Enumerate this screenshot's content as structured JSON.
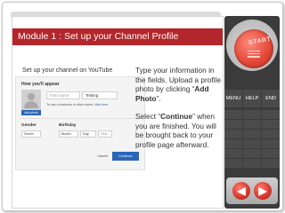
{
  "module": {
    "title": "Module 1 : Set up your Channel Profile"
  },
  "youtube": {
    "heading": "Set up your channel on YouTube",
    "how_label": "How you'll appear",
    "first_name_placeholder": "First name",
    "last_name_value": "Testing",
    "business_text": "To use a business or other name,",
    "business_link": "click here",
    "add_photo": "Add photo",
    "gender_label": "Gender",
    "birthday_label": "Birthday",
    "gender_select": "Select",
    "month_select": "Month",
    "day_select": "Day",
    "year_placeholder": "Year",
    "cancel_label": "Cancel",
    "continue_label": "Continue"
  },
  "instructions": {
    "p1_a": "Type your information in the fields. Upload a profile photo by clicking “",
    "p1_bold": "Add Photo",
    "p1_b": "”.",
    "p2_a": "Select “",
    "p2_bold": "Continue",
    "p2_b": "” when you are finished. You will be brought back to your profile page afterward."
  },
  "panel": {
    "start_label": "START",
    "menu_label": "MENU",
    "help_label": "HELP",
    "end_label": "END",
    "prev_icon": "arrow-left-icon",
    "next_icon": "arrow-right-icon"
  },
  "colors": {
    "title_bar": "#b3262b",
    "panel": "#3b3b3b",
    "start": "#e44a3a",
    "youtube_blue": "#2a66b8"
  }
}
